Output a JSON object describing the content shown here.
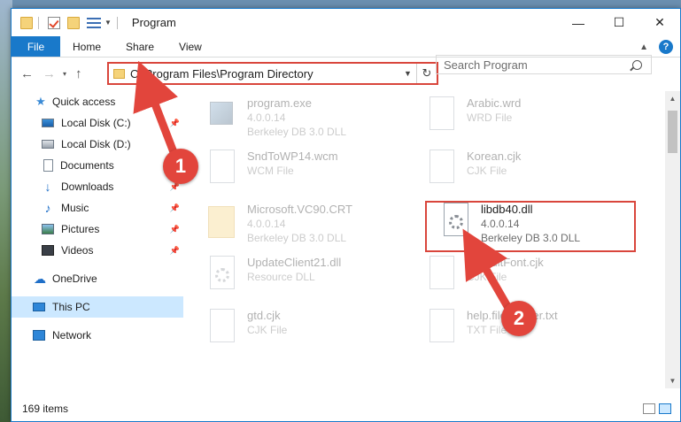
{
  "window": {
    "title": "Program",
    "controls": {
      "minimize": "—",
      "maximize": "☐",
      "close": "✕"
    }
  },
  "ribbon": {
    "tabs": [
      "File",
      "Home",
      "Share",
      "View"
    ]
  },
  "navigation": {
    "back": "←",
    "forward": "→",
    "recent": "▾",
    "up": "↑",
    "address": "C:\\Program Files\\Program Directory",
    "search_placeholder": "Search Program"
  },
  "nav_pane": {
    "items": [
      {
        "label": "Quick access",
        "icon": "star-icon"
      },
      {
        "label": "Local Disk (C:)",
        "icon": "drive-icon",
        "pinned": true
      },
      {
        "label": "Local Disk (D:)",
        "icon": "drive-icon"
      },
      {
        "label": "Documents",
        "icon": "documents-icon",
        "pinned": true
      },
      {
        "label": "Downloads",
        "icon": "downloads-icon",
        "pinned": true
      },
      {
        "label": "Music",
        "icon": "music-icon",
        "pinned": true
      },
      {
        "label": "Pictures",
        "icon": "pictures-icon",
        "pinned": true
      },
      {
        "label": "Videos",
        "icon": "videos-icon",
        "pinned": true
      },
      {
        "label": "OneDrive",
        "icon": "onedrive-icon"
      },
      {
        "label": "This PC",
        "icon": "this-pc-icon",
        "selected": true
      },
      {
        "label": "Network",
        "icon": "network-icon"
      }
    ]
  },
  "files": [
    {
      "name": "program.exe",
      "line1": "4.0.0.14",
      "line2": "Berkeley DB 3.0 DLL",
      "icon": "exe-icon"
    },
    {
      "name": "Arabic.wrd",
      "line1": "WRD File",
      "line2": "",
      "icon": "file-icon"
    },
    {
      "name": "SndToWP14.wcm",
      "line1": "WCM File",
      "line2": "",
      "icon": "file-icon"
    },
    {
      "name": "Korean.cjk",
      "line1": "CJK File",
      "line2": "",
      "icon": "file-icon"
    },
    {
      "name": "Microsoft.VC90.CRT",
      "line1": "4.0.0.14",
      "line2": "Berkeley DB 3.0 DLL",
      "icon": "folder-icon"
    },
    {
      "name": "libdb40.dll",
      "line1": "4.0.0.14",
      "line2": "Berkeley DB 3.0 DLL",
      "icon": "dll-icon",
      "highlighted": true
    },
    {
      "name": "UpdateClient21.dll",
      "line1": "Resource DLL",
      "line2": "",
      "icon": "dll-icon"
    },
    {
      "name": "DefaultFont.cjk",
      "line1": "CJK File",
      "line2": "",
      "icon": "file-icon"
    },
    {
      "name": "gtd.cjk",
      "line1": "CJK File",
      "line2": "",
      "icon": "file-icon"
    },
    {
      "name": "help.file.reader.txt",
      "line1": "TXT File",
      "line2": "",
      "icon": "file-icon"
    }
  ],
  "status": {
    "item_count": "169 items"
  },
  "annotations": {
    "step1": "1",
    "step2": "2",
    "color": "#e2453c"
  }
}
